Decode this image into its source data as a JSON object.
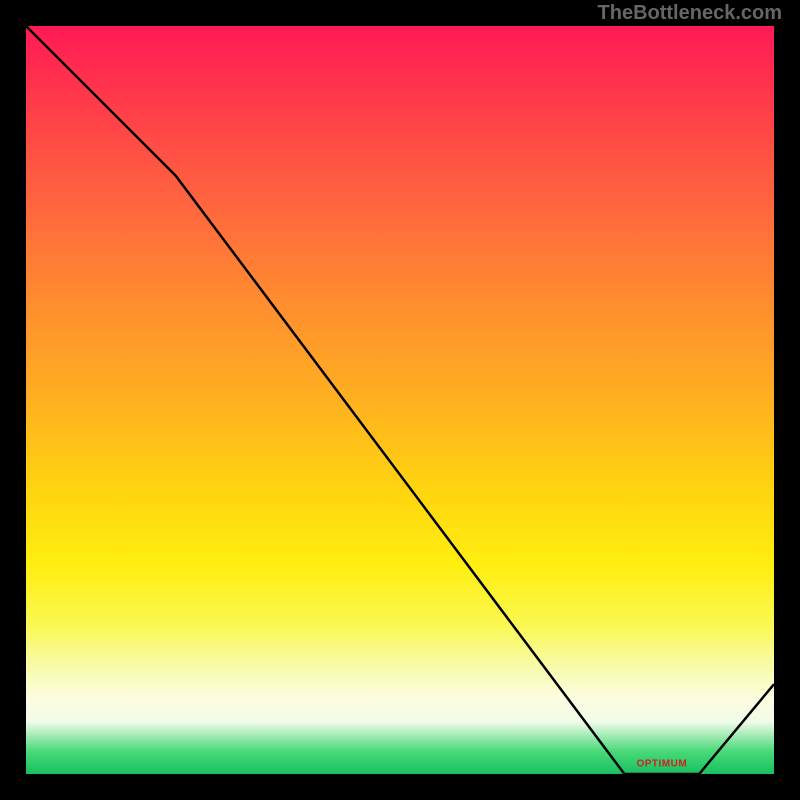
{
  "attribution": "TheBottleneck.com",
  "chart_data": {
    "type": "line",
    "title": "",
    "xlabel": "",
    "ylabel": "",
    "x_range": [
      0,
      100
    ],
    "y_range": [
      0,
      100
    ],
    "x": [
      0,
      20,
      80,
      90,
      100
    ],
    "values": [
      100,
      80,
      0,
      0,
      12
    ],
    "optimum_label": "OPTIMUM",
    "optimum_x": 85,
    "colors": {
      "top": "#ff1a55",
      "mid": "#ffee10",
      "bottom": "#18c060",
      "line": "#000000",
      "marker": "#d02020"
    }
  }
}
